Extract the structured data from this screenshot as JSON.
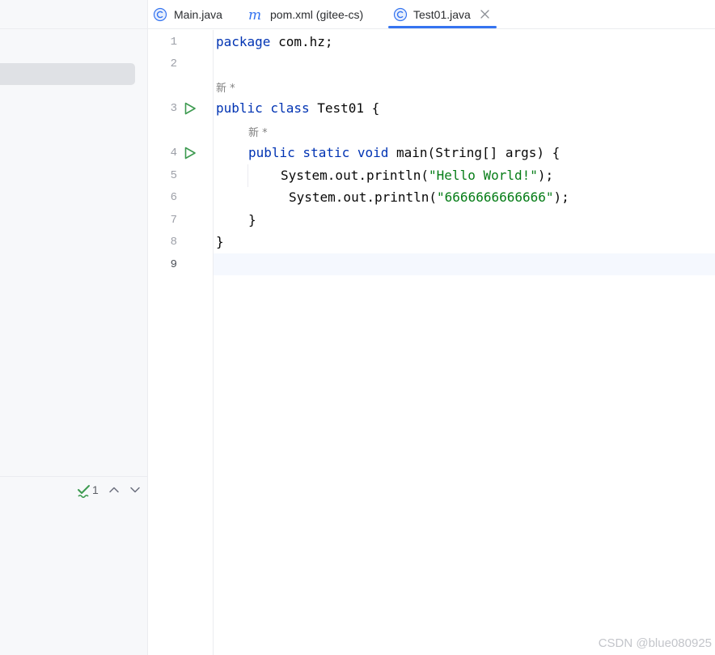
{
  "tabs": [
    {
      "label": "Main.java",
      "icon": "java-class-icon"
    },
    {
      "label": "pom.xml (gitee-cs)",
      "icon": "maven-icon"
    },
    {
      "label": "Test01.java",
      "icon": "java-class-icon",
      "active": true
    }
  ],
  "problems": {
    "count": "1"
  },
  "editor": {
    "line_numbers": [
      "1",
      "2",
      "3",
      "4",
      "5",
      "6",
      "7",
      "8",
      "9"
    ],
    "inlay_hints": [
      "新 *",
      "新 *"
    ],
    "code": {
      "l1_kw": "package",
      "l1_rest": " com.hz;",
      "l3_kw": "public class",
      "l3_rest": " Test01 {",
      "l4_kw": "public static void",
      "l4_rest": " main(String[] args) {",
      "l5_pre": "System.out.println(",
      "l5_str": "\"Hello World!\"",
      "l5_post": ");",
      "l6_pre": "System.out.println(",
      "l6_str": "\"6666666666666\"",
      "l6_post": ");",
      "l7": "}",
      "l8": "}"
    }
  },
  "watermark": "CSDN @blue080925",
  "colors": {
    "keyword": "#0033b3",
    "string": "#067d17",
    "accent": "#3574f0",
    "run": "#3d9a50",
    "check": "#3d9a50"
  }
}
